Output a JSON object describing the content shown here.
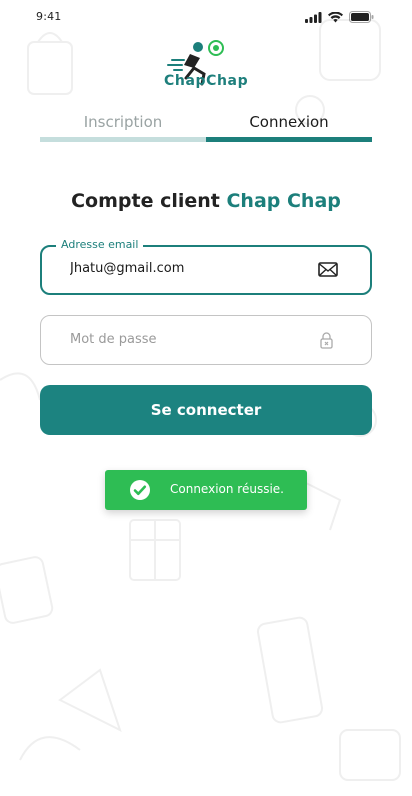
{
  "status_bar": {
    "time": "9:41"
  },
  "brand": {
    "name": "ChapChap"
  },
  "tabs": [
    {
      "label": "Inscription",
      "active": false
    },
    {
      "label": "Connexion",
      "active": true
    }
  ],
  "heading": {
    "prefix": "Compte client",
    "accent": "Chap Chap"
  },
  "form": {
    "email": {
      "label": "Adresse email",
      "value": "Jhatu@gmail.com",
      "icon": "mail-icon"
    },
    "password": {
      "placeholder": "Mot de passe",
      "icon": "lock-icon"
    },
    "submit_label": "Se connecter"
  },
  "toast": {
    "message": "Connexion réussie.",
    "icon": "check-circle-icon"
  },
  "colors": {
    "primary": "#1c7f7b",
    "success": "#2ebd54",
    "tab_inactive_bar": "#c5dedd"
  }
}
